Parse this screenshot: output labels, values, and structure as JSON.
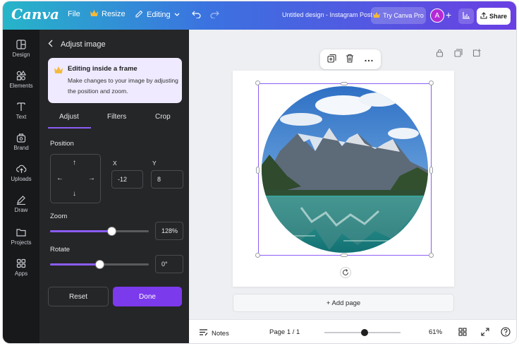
{
  "topbar": {
    "logo": "Canva",
    "file_label": "File",
    "resize_label": "Resize",
    "editing_label": "Editing",
    "design_title": "Untitled design - Instagram Post",
    "pro_label": "Try Canva Pro",
    "avatar_initial": "A",
    "share_label": "Share"
  },
  "rail": {
    "items": [
      {
        "label": "Design",
        "icon": "layout-icon"
      },
      {
        "label": "Elements",
        "icon": "shapes-icon"
      },
      {
        "label": "Text",
        "icon": "text-icon"
      },
      {
        "label": "Brand",
        "icon": "brand-icon"
      },
      {
        "label": "Uploads",
        "icon": "cloud-upload-icon"
      },
      {
        "label": "Draw",
        "icon": "pen-icon"
      },
      {
        "label": "Projects",
        "icon": "folder-icon"
      },
      {
        "label": "Apps",
        "icon": "apps-grid-icon"
      }
    ]
  },
  "panel": {
    "title": "Adjust image",
    "info_title": "Editing inside a frame",
    "info_desc": "Make changes to your image by adjusting the position and zoom.",
    "tabs": [
      "Adjust",
      "Filters",
      "Crop"
    ],
    "active_tab": "Adjust",
    "position_label": "Position",
    "x_label": "X",
    "y_label": "Y",
    "x_value": "-12",
    "y_value": "8",
    "zoom_label": "Zoom",
    "zoom_value": "128%",
    "zoom_fraction": 0.62,
    "rotate_label": "Rotate",
    "rotate_value": "0°",
    "rotate_fraction": 0.5,
    "reset_label": "Reset",
    "done_label": "Done"
  },
  "canvas": {
    "add_page_label": "+ Add page"
  },
  "bottombar": {
    "notes_label": "Notes",
    "page_label": "Page 1 / 1",
    "zoom_level": "61%",
    "zoom_fraction": 0.48
  },
  "colors": {
    "accent": "#8b5cf6",
    "done": "#7c3aed",
    "panel_bg": "#252627",
    "rail_bg": "#18191b"
  }
}
